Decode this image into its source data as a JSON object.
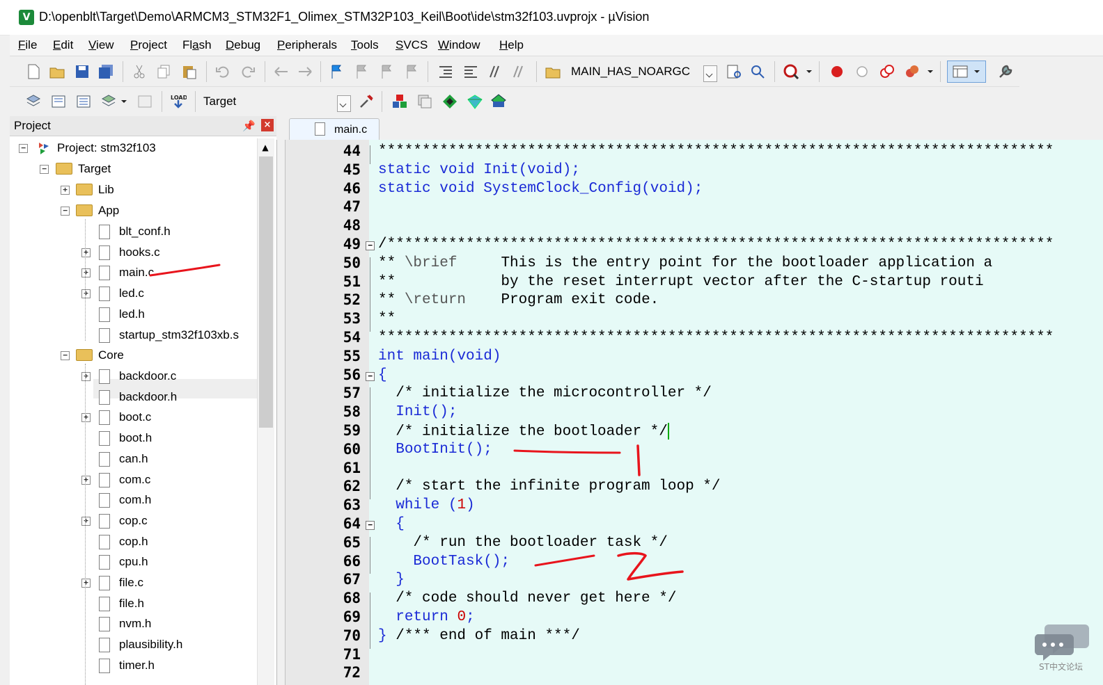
{
  "window": {
    "title": "D:\\openblt\\Target\\Demo\\ARMCM3_STM32F1_Olimex_STM32P103_Keil\\Boot\\ide\\stm32f103.uvprojx - µVision",
    "app_icon": "V"
  },
  "menu": [
    {
      "ul": "F",
      "rest": "ile"
    },
    {
      "ul": "E",
      "rest": "dit"
    },
    {
      "ul": "V",
      "rest": "iew"
    },
    {
      "ul": "P",
      "rest": "roject"
    },
    {
      "pre": "Fl",
      "ul": "a",
      "rest": "sh"
    },
    {
      "ul": "D",
      "rest": "ebug"
    },
    {
      "ul": "P",
      "rest": "eripherals"
    },
    {
      "ul": "T",
      "rest": "ools"
    },
    {
      "ul": "S",
      "rest": "VCS"
    },
    {
      "ul": "W",
      "rest": "indow"
    },
    {
      "ul": "H",
      "rest": "elp"
    }
  ],
  "toolbar": {
    "define_combo": "MAIN_HAS_NOARGC",
    "target_combo": "Target",
    "load_label": "LOAD"
  },
  "project_panel": {
    "title": "Project",
    "pin": "📌",
    "close": "×",
    "tree": {
      "project": "Project: stm32f103",
      "target": "Target",
      "lib": "Lib",
      "app": "App",
      "app_files": [
        "blt_conf.h",
        "hooks.c",
        "main.c",
        "led.c",
        "led.h",
        "startup_stm32f103xb.s"
      ],
      "core": "Core",
      "core_files": [
        "backdoor.c",
        "backdoor.h",
        "boot.c",
        "boot.h",
        "can.h",
        "com.c",
        "com.h",
        "cop.c",
        "cop.h",
        "cpu.h",
        "file.c",
        "file.h",
        "nvm.h",
        "plausibility.h",
        "timer.h"
      ]
    }
  },
  "editor": {
    "tab": "main.c",
    "lines": [
      {
        "n": "44",
        "t": "*****************************************************************************"
      },
      {
        "n": "45",
        "t": "static void Init(void);"
      },
      {
        "n": "46",
        "t": "static void SystemClock_Config(void);"
      },
      {
        "n": "47",
        "t": ""
      },
      {
        "n": "48",
        "t": ""
      },
      {
        "n": "49",
        "t": "/****************************************************************************"
      },
      {
        "n": "50",
        "t": "** \\brief     This is the entry point for the bootloader application a"
      },
      {
        "n": "51",
        "t": "**            by the reset interrupt vector after the C-startup routi"
      },
      {
        "n": "52",
        "t": "** \\return    Program exit code."
      },
      {
        "n": "53",
        "t": "**"
      },
      {
        "n": "54",
        "t": "*****************************************************************************"
      },
      {
        "n": "55",
        "t": "int main(void)"
      },
      {
        "n": "56",
        "t": "{"
      },
      {
        "n": "57",
        "t": "  /* initialize the microcontroller */"
      },
      {
        "n": "58",
        "t": "  Init();"
      },
      {
        "n": "59",
        "t": "  /* initialize the bootloader */"
      },
      {
        "n": "60",
        "t": "  BootInit();"
      },
      {
        "n": "61",
        "t": ""
      },
      {
        "n": "62",
        "t": "  /* start the infinite program loop */"
      },
      {
        "n": "63",
        "t": "  while (1)"
      },
      {
        "n": "64",
        "t": "  {"
      },
      {
        "n": "65",
        "t": "    /* run the bootloader task */"
      },
      {
        "n": "66",
        "t": "    BootTask();"
      },
      {
        "n": "67",
        "t": "  }"
      },
      {
        "n": "68",
        "t": "  /* code should never get here */"
      },
      {
        "n": "69",
        "t": "  return 0;"
      },
      {
        "n": "70",
        "t": "} /*** end of main ***/"
      },
      {
        "n": "71",
        "t": ""
      },
      {
        "n": "72",
        "t": ""
      }
    ]
  },
  "watermark": {
    "text": "ST中文论坛"
  },
  "colors": {
    "keyword": "#1a2ad6",
    "number": "#cc0000",
    "editor_bg": "#e6faf7",
    "annotation": "#e8141c"
  }
}
